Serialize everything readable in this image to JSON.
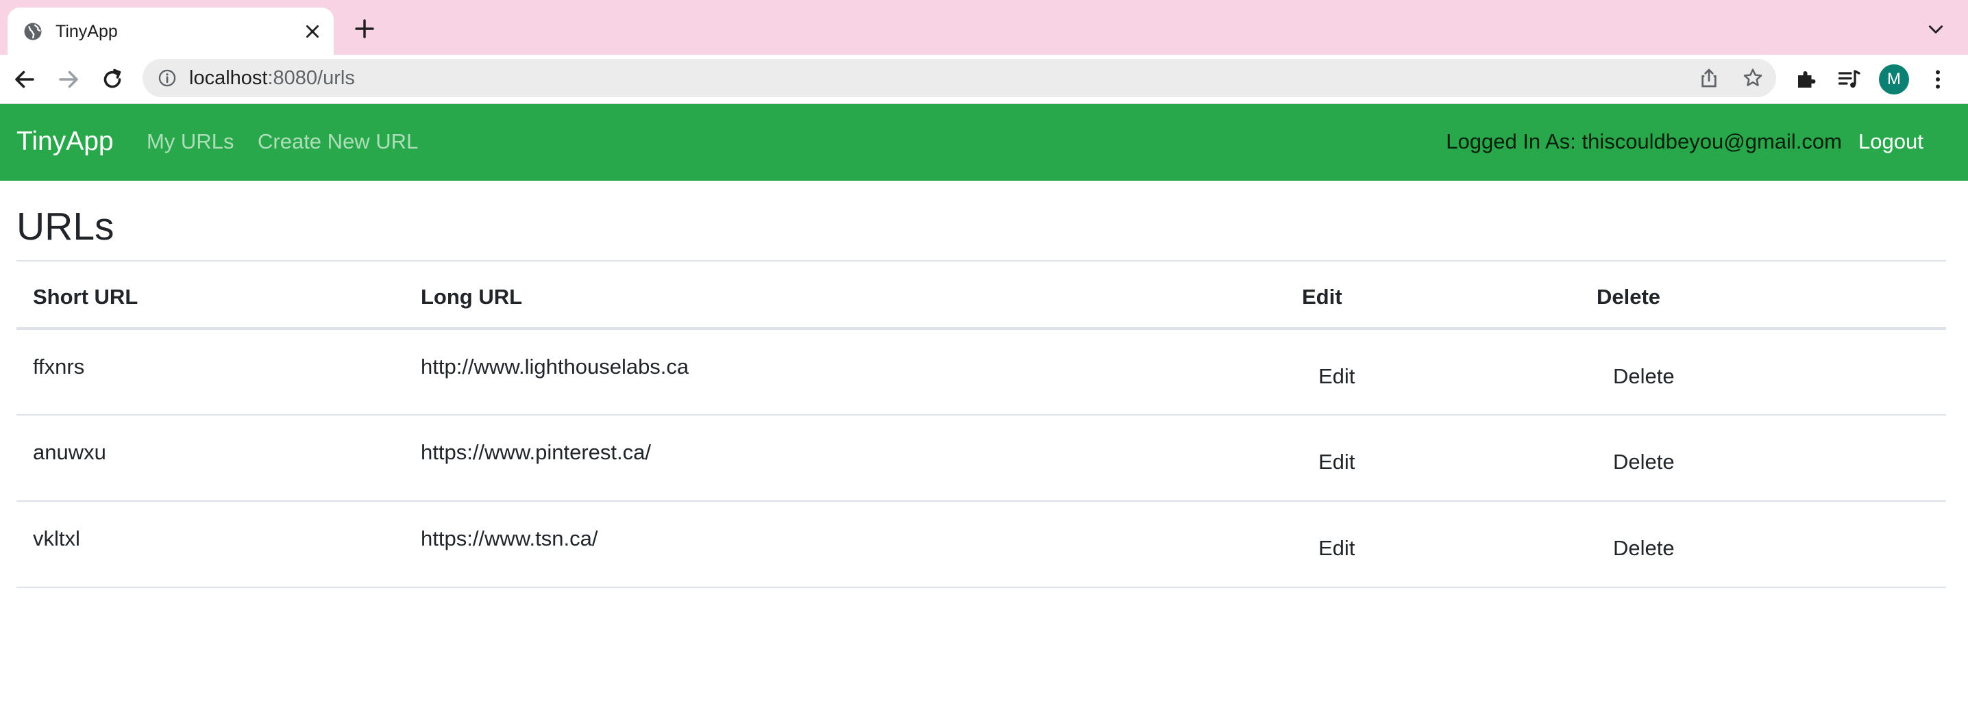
{
  "browser": {
    "tab_title": "TinyApp",
    "url_host": "localhost",
    "url_path": ":8080/urls",
    "profile_initial": "M",
    "colors": {
      "tabstrip": "#f7d3e4",
      "avatar": "#0b8073"
    }
  },
  "navbar": {
    "brand": "TinyApp",
    "links": [
      "My URLs",
      "Create New URL"
    ],
    "logged_in_label": "Logged In As: thiscouldbeyou@gmail.com",
    "logout_label": "Logout",
    "color": "#28a84a"
  },
  "main": {
    "title": "URLs",
    "table": {
      "headers": [
        "Short URL",
        "Long URL",
        "Edit",
        "Delete"
      ],
      "rows": [
        {
          "short": "ffxnrs",
          "long": "http://www.lighthouselabs.ca",
          "edit": "Edit",
          "delete": "Delete"
        },
        {
          "short": "anuwxu",
          "long": "https://www.pinterest.ca/",
          "edit": "Edit",
          "delete": "Delete"
        },
        {
          "short": "vkltxl",
          "long": "https://www.tsn.ca/",
          "edit": "Edit",
          "delete": "Delete"
        }
      ]
    }
  }
}
